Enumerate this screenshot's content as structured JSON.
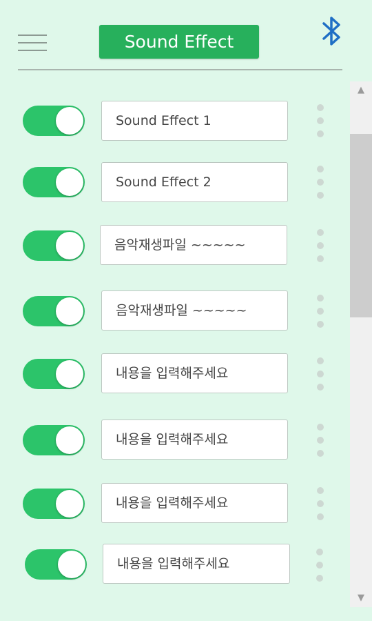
{
  "header": {
    "title": "Sound Effect",
    "menu_icon": "hamburger-menu-icon",
    "bluetooth_icon": "bluetooth-icon",
    "bluetooth_color": "#1f6fc5",
    "accent_color": "#27b05c"
  },
  "items": [
    {
      "enabled": true,
      "label": "Sound Effect 1"
    },
    {
      "enabled": true,
      "label": "Sound Effect 2"
    },
    {
      "enabled": true,
      "label": "음악재생파일 ~~~~~"
    },
    {
      "enabled": true,
      "label": "음악재생파일 ~~~~~"
    },
    {
      "enabled": true,
      "label": "내용을 입력해주세요"
    },
    {
      "enabled": true,
      "label": "내용을 입력해주세요"
    },
    {
      "enabled": true,
      "label": "내용을 입력해주세요"
    },
    {
      "enabled": true,
      "label": "내용을 입력해주세요"
    }
  ],
  "scrollbar": {
    "up_icon": "scroll-up-arrow-icon",
    "down_icon": "scroll-down-arrow-icon"
  }
}
